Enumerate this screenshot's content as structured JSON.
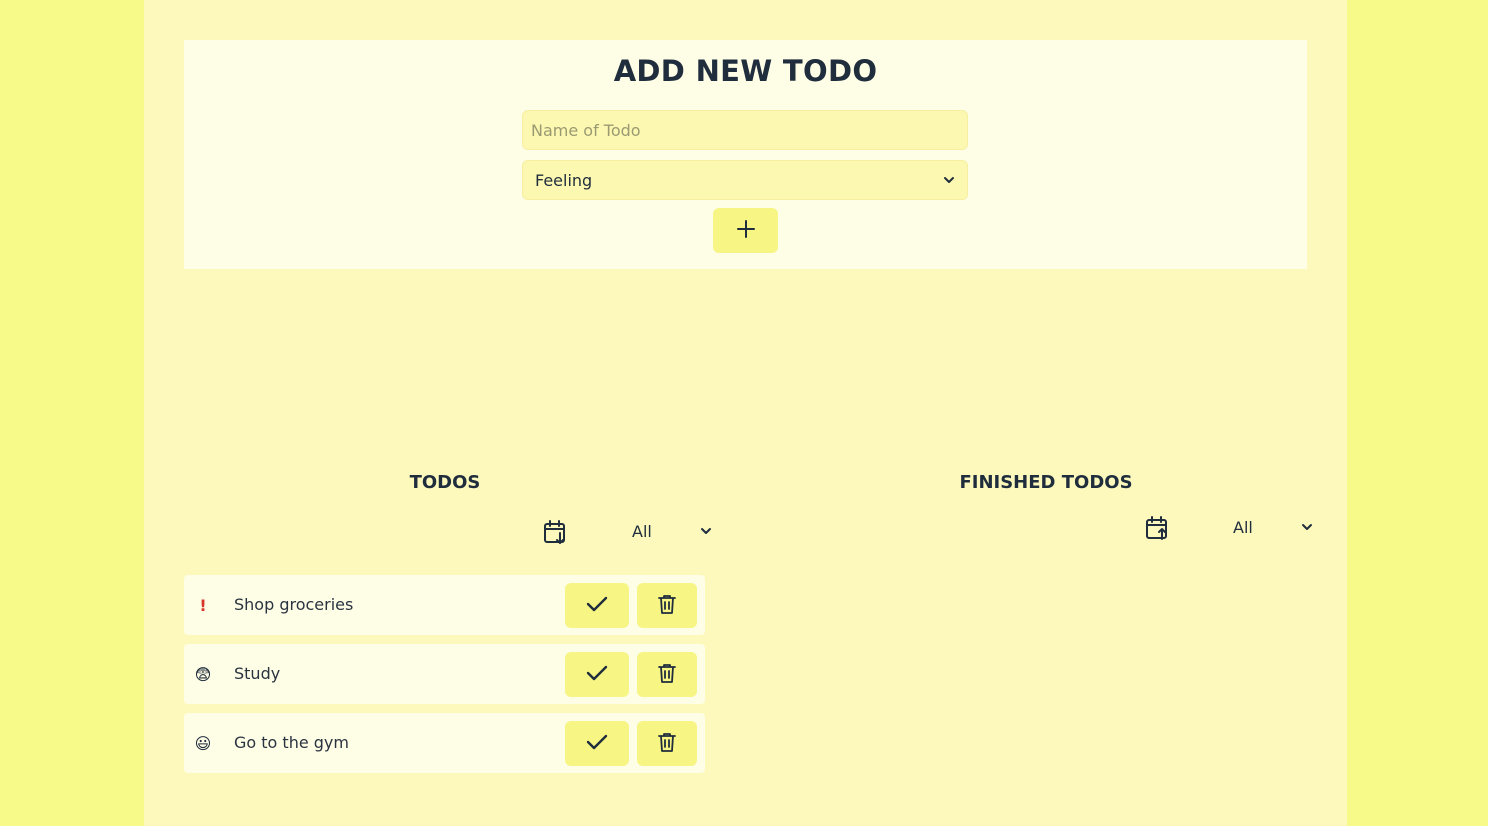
{
  "add_todo": {
    "title": "ADD NEW TODO",
    "name_placeholder": "Name of Todo",
    "name_value": "",
    "feeling_selected": "Feeling",
    "add_label": "+"
  },
  "todos": {
    "title": "TODOS",
    "sort_icon": "calendar-sort-down-icon",
    "filter_selected": "All",
    "items": [
      {
        "feeling": "!",
        "feeling_icon": "exclamation-icon",
        "text": "Shop groceries"
      },
      {
        "feeling": "😨",
        "feeling_icon": "anxious-face-icon",
        "text": "Study"
      },
      {
        "feeling": "😃",
        "feeling_icon": "grinning-face-icon",
        "text": "Go to the gym"
      }
    ]
  },
  "finished": {
    "title": "FINISHED TODOS",
    "sort_icon": "calendar-sort-up-icon",
    "filter_selected": "All",
    "items": []
  },
  "colors": {
    "outer_bg": "#f7fa88",
    "page_bg": "#fdf9bd",
    "card_bg": "#fefde6",
    "button_bg": "#f7f583",
    "text": "#1f2d3d",
    "exclamation": "#d9342b"
  }
}
